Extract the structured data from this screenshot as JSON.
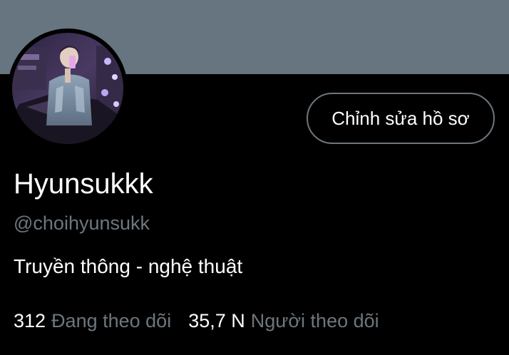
{
  "profile": {
    "display_name": "Hyunsukkk",
    "handle": "@choihyunsukk",
    "bio": "Truyền thông - nghệ thuật",
    "edit_button_label": "Chỉnh sửa hồ sơ"
  },
  "stats": {
    "following_count": "312",
    "following_label": "Đang theo dõi",
    "followers_count": "35,7 N",
    "followers_label": "Người theo dõi"
  },
  "colors": {
    "background": "#000000",
    "banner": "#66757f",
    "secondary_text": "#6e767d",
    "primary_text": "#ffffff"
  }
}
